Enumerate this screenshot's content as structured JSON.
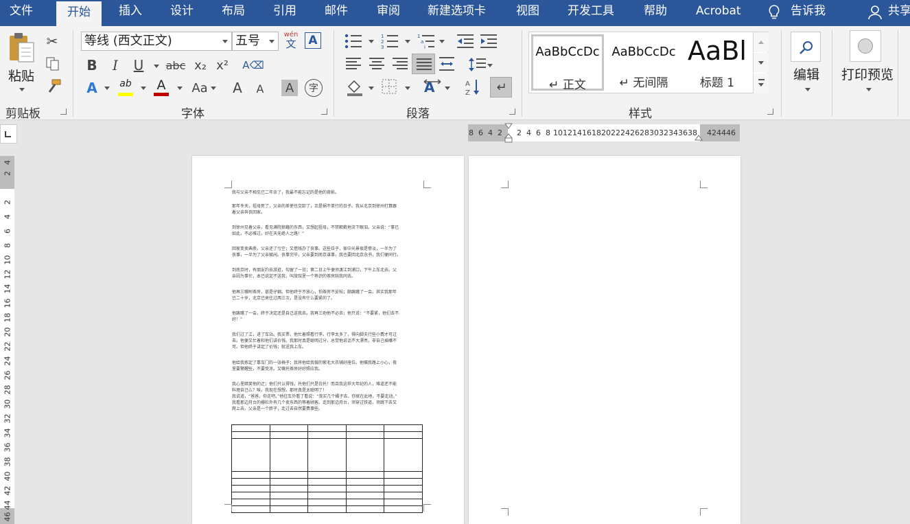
{
  "tabs": {
    "file": "文件",
    "home": "开始",
    "insert": "插入",
    "design": "设计",
    "layout": "布局",
    "references": "引用",
    "mailings": "邮件",
    "review": "审阅",
    "new_tab": "新建选项卡",
    "view": "视图",
    "developer": "开发工具",
    "help": "帮助",
    "acrobat": "Acrobat",
    "tell_me": "告诉我",
    "share": "共享"
  },
  "clipboard": {
    "paste": "粘贴",
    "label": "剪贴板"
  },
  "font": {
    "name": "等线 (西文正文)",
    "size": "五号",
    "wen": "wén",
    "wen_char": "文",
    "bold": "B",
    "italic": "I",
    "underline": "U",
    "strike": "abc",
    "sub": "x₂",
    "sup": "x²",
    "font_color": "A",
    "change_case": "Aa",
    "grow": "A",
    "shrink": "A",
    "shade": "A",
    "enclose": "字",
    "highlight": "ab",
    "label": "字体"
  },
  "paragraph": {
    "label": "段落"
  },
  "styles": {
    "label": "样式",
    "items": [
      {
        "preview": "AaBbCcDc",
        "name": "正文"
      },
      {
        "preview": "AaBbCcDc",
        "name": "无间隔"
      },
      {
        "preview": "AaBl",
        "name": "标题 1"
      }
    ],
    "para_mark": "↵"
  },
  "editing": {
    "label": "编辑"
  },
  "print_preview": {
    "label": "打印预览"
  },
  "ruler": {
    "h_left": [
      "8",
      "6",
      "4",
      "2"
    ],
    "h_right": [
      "2",
      "4",
      "6",
      "8",
      "10",
      "12",
      "14",
      "16",
      "18",
      "20",
      "22",
      "24",
      "26",
      "28",
      "30",
      "32",
      "34",
      "36",
      "38"
    ],
    "h_margin": [
      "42",
      "44",
      "46"
    ],
    "v_top": [
      "4",
      "2"
    ],
    "v_main": [
      "2",
      "4",
      "6",
      "8",
      "10",
      "12",
      "14",
      "16",
      "18",
      "20",
      "22",
      "24",
      "26",
      "28",
      "30",
      "32",
      "34",
      "36",
      "38",
      "40",
      "42",
      "44",
      "46"
    ]
  },
  "document": {
    "paragraphs": [
      [
        "我与父亲不相见已二年余了，我最不能忘记的是他的背影。"
      ],
      [
        "那年冬天，祖母死了，父亲的差使也交卸了，正是祸不单行的日子。我从北京到徐州打算跟",
        "着父亲奔丧回家。"
      ],
      [
        "到徐州见着父亲，看见满院狼藉的东西，又想起祖母，不禁簌簌地流下眼泪。父亲说：“事已",
        "如此，不必难过，好在天无绝人之路！”"
      ],
      [
        "回家变卖典质，父亲还了亏空；又借钱办了丧事。这些日子，家中光景很是惨淡，一半为了",
        "丧事，一半为了父亲赋闲。丧事完毕，父亲要到南京谋事，我也要回北京念书，我们便同行。"
      ],
      [
        "到南京时，有朋友约去游逛，勾留了一日；第二日上午便须渡江到浦口，下午上车北去。父",
        "亲因为事忙，本已说定不送我，叫旅馆里一个熟识的茶房陪我同去。"
      ],
      [
        "他再三嘱咐茶房，甚是仔细。但他终于不放心，怕茶房不妥帖；颇踌躇了一会。其实我那年",
        "已二十岁，北京已来往过两三次，是没有什么要紧的了。"
      ],
      [
        "他踌躇了一会，终于决定还是自己送我去。我再三劝他不必去；他只说：“不要紧，他们去不",
        "好！”"
      ],
      [
        "我们过了江，进了车站。我买票，他忙着照看行李。行李太多了，得向脚夫行些小费才可过",
        "去。他便又忙着和他们讲价钱。我那时真是聪明过分，总觉他说话不大漂亮，非自己插嘴不",
        "可。但他终于讲定了价钱；就送我上车。"
      ],
      [
        "他给我拣定了靠车门的一张椅子；我将他给我做的紫毛大衣铺好座位。他嘱我路上小心，夜",
        "里要警醒些，不要受凉。又嘱托茶房好好照应我。"
      ],
      [
        "我心里暗笑他的迂；他们只认得钱，托他们只是白托！而且我这样大年纪的人，难道还不能",
        "料理自己么？唉，我现在想想，那时真是太聪明了！",
        "我说道，“爸爸，你走吧。”他往车外看了看说：“我买几个橘子去。你就在此地，不要走动。”",
        "我看那边月台的栅栏外有几个卖东西的等着顾客。走到那边月台，须穿过铁道，须跳下去又",
        "爬上去。父亲是一个胖子，走过去自然要费事些。"
      ]
    ]
  }
}
